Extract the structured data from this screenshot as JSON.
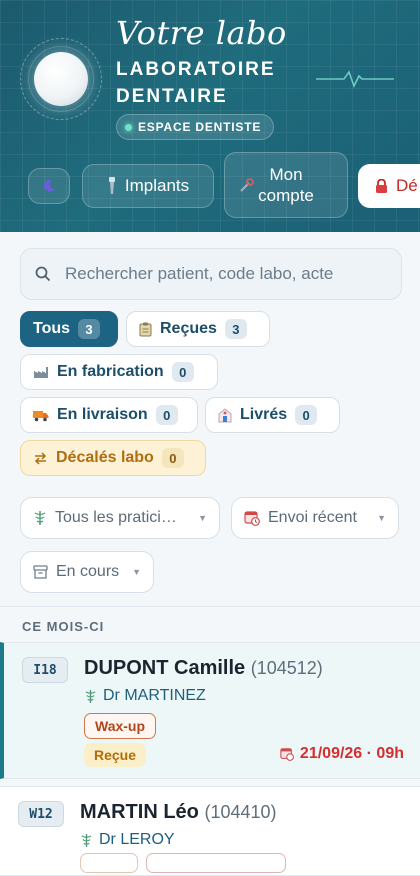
{
  "header": {
    "script_title": "Votre labo",
    "lab_title_line1": "LABORATOIRE",
    "lab_title_line2": "DENTAIRE",
    "space_badge": "ESPACE DENTISTE"
  },
  "nav": {
    "implants": "Implants",
    "account_line1": "Mon",
    "account_line2": "compte",
    "logout": "Dé"
  },
  "search": {
    "placeholder": "Rechercher patient, code labo, acte"
  },
  "status_chips": {
    "all": {
      "label": "Tous",
      "count": "3"
    },
    "recues": {
      "label": "Reçues",
      "count": "3"
    },
    "fabrication": {
      "label": "En fabrication",
      "count": "0"
    },
    "livraison": {
      "label": "En livraison",
      "count": "0"
    },
    "livres": {
      "label": "Livrés",
      "count": "0"
    },
    "decales": {
      "label": "Décalés labo",
      "count": "0"
    }
  },
  "filters": {
    "practitioners": "Tous les pratici…",
    "sort": "Envoi récent",
    "state": "En cours"
  },
  "section": {
    "title": "CE MOIS-CI"
  },
  "cases": [
    {
      "code": "I18",
      "patient": "DUPONT Camille",
      "ref": "(104512)",
      "doctor": "Dr MARTINEZ",
      "work": "Wax-up",
      "status": "Reçue",
      "date": "21/09/26 · 09h"
    },
    {
      "code": "W12",
      "patient": "MARTIN Léo",
      "ref": "(104410)",
      "doctor": "Dr LEROY"
    }
  ],
  "colors": {
    "header": "#1f6c7d",
    "primary": "#1d6383",
    "danger": "#d32f2f",
    "warning": "#b36d08"
  }
}
